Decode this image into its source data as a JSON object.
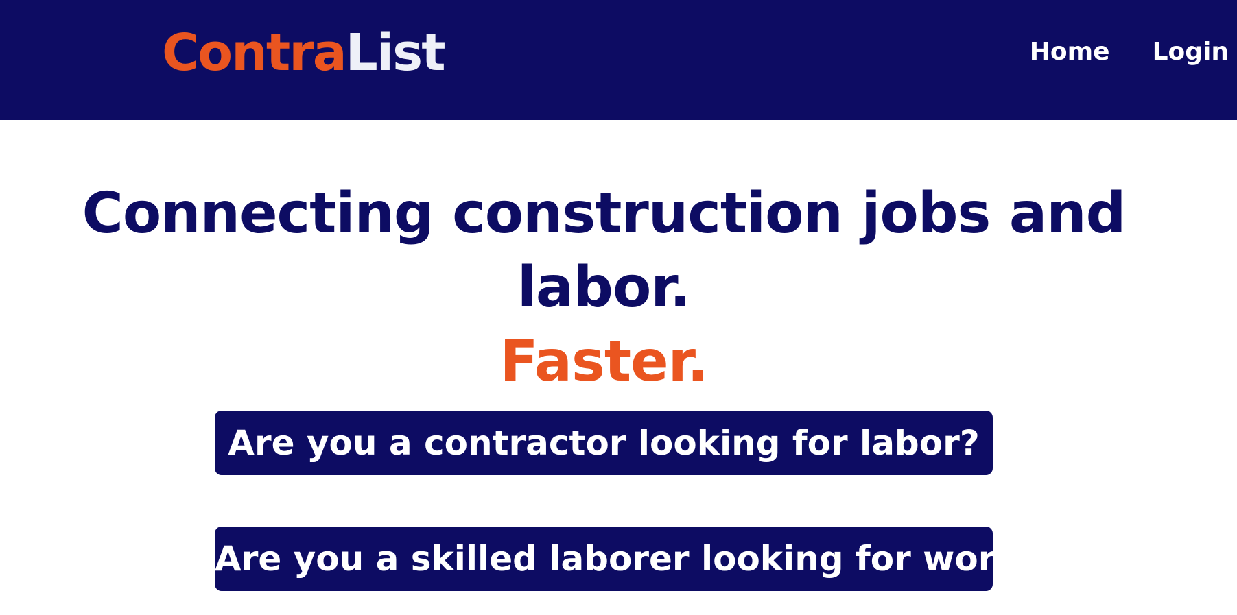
{
  "colors": {
    "navy": "#0d0c63",
    "orange": "#ea5520",
    "white": "#ffffff"
  },
  "header": {
    "logo": {
      "part1": "Contra",
      "part2": "List"
    },
    "nav": [
      {
        "label": "Home"
      },
      {
        "label": "Login"
      }
    ]
  },
  "hero": {
    "headline": "Connecting construction jobs and labor.",
    "accent": "Faster."
  },
  "cta": {
    "contractor_label": "Are you a contractor looking for labor?",
    "laborer_label": "Are you a skilled laborer looking for work?"
  }
}
